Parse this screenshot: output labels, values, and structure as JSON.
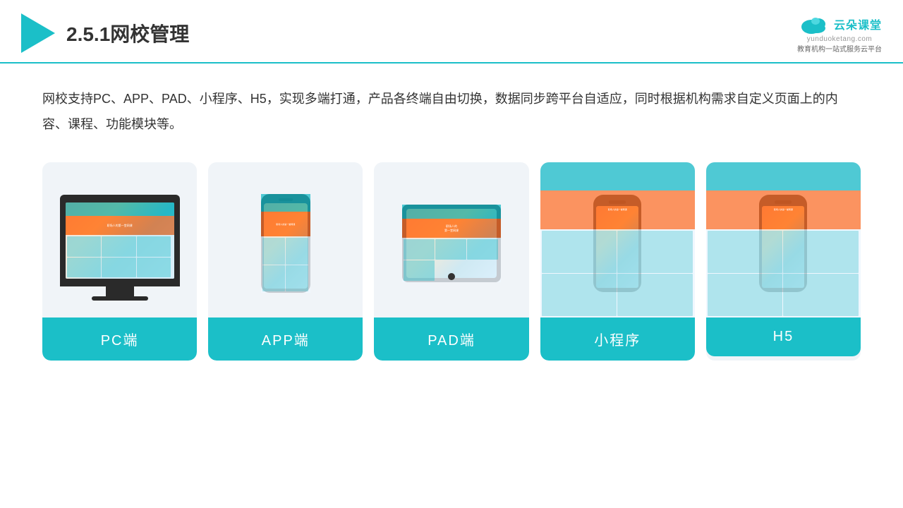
{
  "header": {
    "title": "2.5.1网校管理",
    "title_num": "2.5.1",
    "title_text": "网校管理",
    "logo_name": "云朵课堂",
    "logo_url": "yunduoketang.com",
    "logo_slogan": "教育机构一站式服务云平台"
  },
  "description": {
    "text": "网校支持PC、APP、PAD、小程序、H5，实现多端打通，产品各终端自由切换，数据同步跨平台自适应，同时根据机构需求自定义页面上的内容、课程、功能模块等。"
  },
  "cards": [
    {
      "id": "pc",
      "label": "PC端"
    },
    {
      "id": "app",
      "label": "APP端"
    },
    {
      "id": "pad",
      "label": "PAD端"
    },
    {
      "id": "miniprogram",
      "label": "小程序"
    },
    {
      "id": "h5",
      "label": "H5"
    }
  ],
  "accent_color": "#1BBFC8"
}
